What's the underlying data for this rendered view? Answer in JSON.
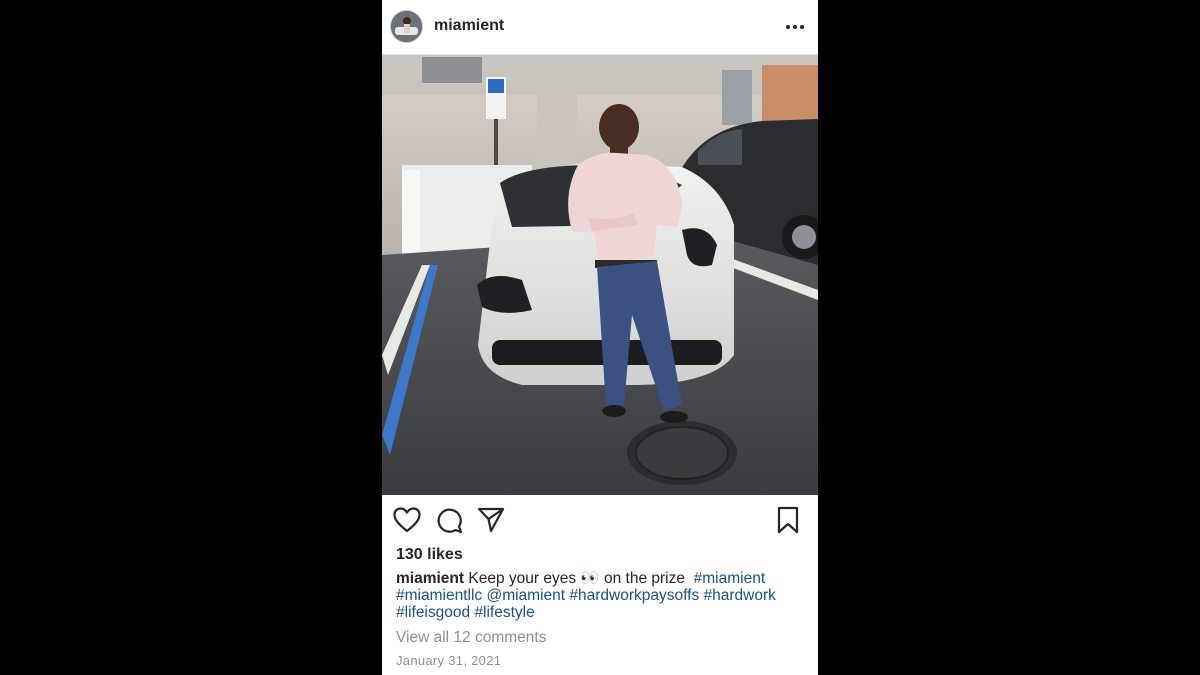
{
  "post": {
    "username": "miamient",
    "more_icon": "more-horizontal-icon",
    "photo_alt": "Man in pink shirt standing in front of a white sports car in a parking garage",
    "actions": {
      "like_icon": "heart-icon",
      "comment_icon": "comment-bubble-icon",
      "share_icon": "send-paper-plane-icon",
      "save_icon": "bookmark-icon"
    },
    "likes": "130 likes",
    "caption": {
      "username": "miamient",
      "text": "Keep your eyes 👀 on the prize",
      "tags": [
        "#miamient",
        "#miamientllc",
        "@miamient",
        "#hardworkpaysoffs",
        "#hardwork",
        "#lifeisgood",
        "#lifestyle"
      ]
    },
    "view_comments": "View all 12 comments",
    "date": "January 31, 2021"
  },
  "colors": {
    "background": "#000000",
    "card": "#ffffff",
    "text": "#262626",
    "link": "#1a4f8a",
    "muted": "#8e8e8e"
  }
}
